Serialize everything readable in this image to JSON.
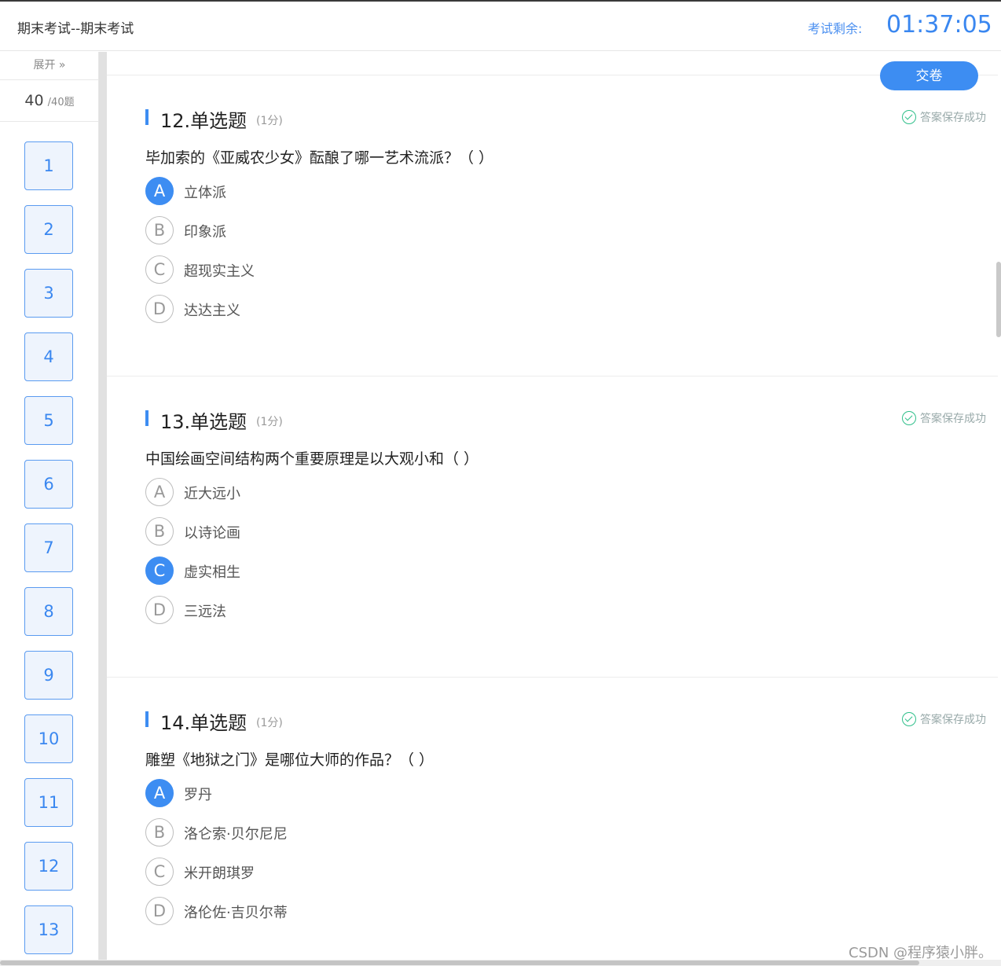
{
  "header": {
    "exam_title": "期末考试--期末考试",
    "timer_label": "考试剩余:",
    "timer_value": "01:37:05"
  },
  "sidebar": {
    "expand_label": "展开 »",
    "answered_count": "40",
    "total_label": "/40题",
    "question_numbers": [
      "1",
      "2",
      "3",
      "4",
      "5",
      "6",
      "7",
      "8",
      "9",
      "10",
      "11",
      "12",
      "13"
    ]
  },
  "main": {
    "submit_label": "交卷",
    "questions": [
      {
        "title": "12.单选题",
        "score": "(1分)",
        "saved": "答案保存成功",
        "text": "毕加索的《亚威农少女》酝酿了哪一艺术流派？（ ）",
        "options": [
          {
            "letter": "A",
            "text": "立体派",
            "selected": true
          },
          {
            "letter": "B",
            "text": "印象派",
            "selected": false
          },
          {
            "letter": "C",
            "text": "超现实主义",
            "selected": false
          },
          {
            "letter": "D",
            "text": "达达主义",
            "selected": false
          }
        ]
      },
      {
        "title": "13.单选题",
        "score": "(1分)",
        "saved": "答案保存成功",
        "text": "中国绘画空间结构两个重要原理是以大观小和（ ）",
        "options": [
          {
            "letter": "A",
            "text": "近大远小",
            "selected": false
          },
          {
            "letter": "B",
            "text": "以诗论画",
            "selected": false
          },
          {
            "letter": "C",
            "text": "虚实相生",
            "selected": true
          },
          {
            "letter": "D",
            "text": "三远法",
            "selected": false
          }
        ]
      },
      {
        "title": "14.单选题",
        "score": "(1分)",
        "saved": "答案保存成功",
        "text": "雕塑《地狱之门》是哪位大师的作品？（ ）",
        "options": [
          {
            "letter": "A",
            "text": "罗丹",
            "selected": true
          },
          {
            "letter": "B",
            "text": "洛仑索·贝尔尼尼",
            "selected": false
          },
          {
            "letter": "C",
            "text": "米开朗琪罗",
            "selected": false
          },
          {
            "letter": "D",
            "text": "洛伦佐·吉贝尔蒂",
            "selected": false
          }
        ]
      }
    ]
  },
  "watermark": "CSDN @程序猿小胖。",
  "colors": {
    "accent": "#3d8df2",
    "saved_check": "#2fbf8a"
  }
}
